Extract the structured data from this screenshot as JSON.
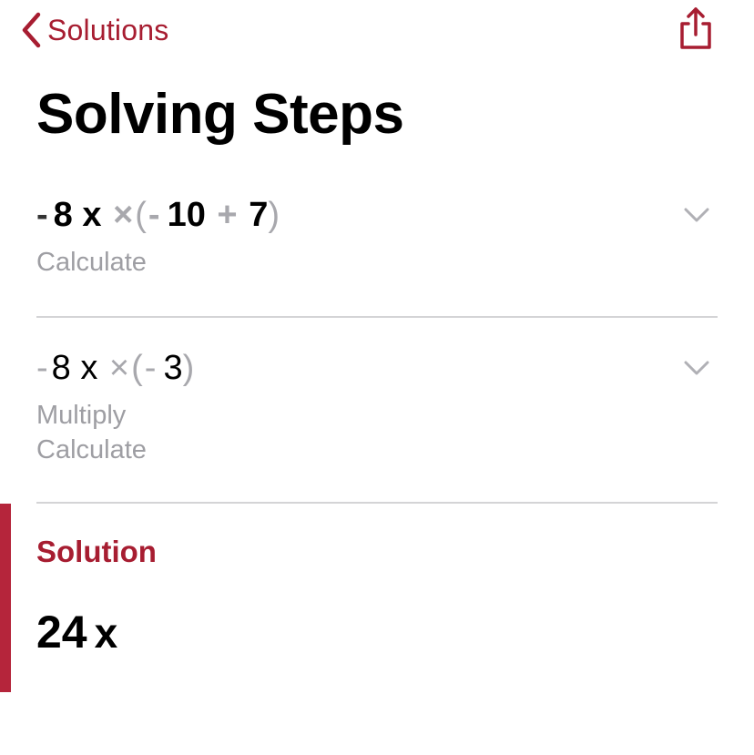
{
  "nav": {
    "back_label": "Solutions",
    "back_icon": "chevron-left-icon",
    "share_icon": "share-icon"
  },
  "page": {
    "title": "Solving Steps"
  },
  "steps": [
    {
      "expression": [
        {
          "type": "num",
          "text": "-"
        },
        {
          "type": "num",
          "text": "8"
        },
        {
          "type": "var",
          "text": "x"
        },
        {
          "type": "op",
          "text": "×"
        },
        {
          "type": "paren",
          "text": "("
        },
        {
          "type": "op",
          "text": "-"
        },
        {
          "type": "num",
          "text": "10"
        },
        {
          "type": "op",
          "text": "+"
        },
        {
          "type": "num",
          "text": "7"
        },
        {
          "type": "paren",
          "text": ")"
        }
      ],
      "descriptions": [
        "Calculate"
      ],
      "expand_icon": "chevron-down-icon"
    },
    {
      "expression": [
        {
          "type": "op",
          "text": "-"
        },
        {
          "type": "num",
          "text": "8"
        },
        {
          "type": "var",
          "text": "x"
        },
        {
          "type": "op",
          "text": "×"
        },
        {
          "type": "paren",
          "text": "("
        },
        {
          "type": "op",
          "text": "-"
        },
        {
          "type": "num",
          "text": "3"
        },
        {
          "type": "paren",
          "text": ")"
        }
      ],
      "descriptions": [
        "Multiply",
        "Calculate"
      ],
      "expand_icon": "chevron-down-icon"
    }
  ],
  "solution": {
    "label": "Solution",
    "value_number": "24",
    "value_variable": "x"
  },
  "colors": {
    "accent": "#a71d31",
    "accent_bar": "#b5253b",
    "muted_text": "#9e9ea3",
    "operator": "#a8a8ad",
    "divider": "#d4d4d6"
  }
}
